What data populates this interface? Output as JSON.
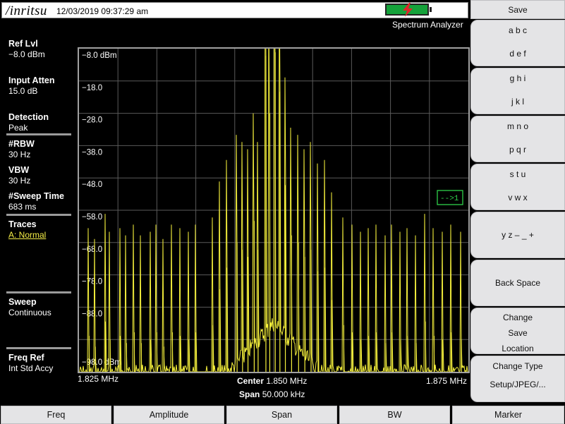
{
  "header": {
    "logo": "/inritsu",
    "datetime": "12/03/2019 09:37:29 am",
    "mode": "Spectrum Analyzer",
    "battery_color": "#15a23a",
    "bolt_color": "#e0262a",
    "battery_icon": "battery-charging-icon"
  },
  "params": [
    {
      "label": "Ref Lvl",
      "value": "−8.0 dBm"
    },
    {
      "label": "Input Atten",
      "value": "15.0 dB"
    },
    {
      "label": "Detection",
      "value": "Peak"
    },
    {
      "label": "#RBW",
      "value": "30 Hz"
    },
    {
      "label": "VBW",
      "value": "30 Hz"
    },
    {
      "label": "#Sweep Time",
      "value": "683 ms"
    },
    {
      "label": "Traces",
      "value": "A: Normal"
    },
    {
      "label": "Sweep",
      "value": "Continuous"
    },
    {
      "label": "Freq Ref",
      "value": "Int Std Accy"
    }
  ],
  "graph": {
    "ref_label": "−8.0 dBm",
    "y_tick_labels": [
      "−18.0",
      "−28.0",
      "−38.0",
      "−48.0",
      "−58.0",
      "−68.0",
      "−78.0",
      "−88.0"
    ],
    "bottom_label": "−98.0 dBm",
    "marker_flag": "-->1",
    "trace_color": "#f5f03c",
    "grid_color": "#5a5a5a",
    "freq_start": "1.825 MHz",
    "freq_stop": "1.875 MHz",
    "center_label": "Center",
    "center_value": "1.850 MHz",
    "span_label": "Span",
    "span_value": "50.000 kHz"
  },
  "softkeys": {
    "save": "Save",
    "abc": "a b c",
    "def": "d e f",
    "ghi": "g h i",
    "jkl": "j k l",
    "mno": "m n o",
    "pqr": "p q r",
    "stu": "s t u",
    "vwx": "v w x",
    "yz": "y z – _ +",
    "backspace": "Back Space",
    "change_save_1": "Change",
    "change_save_2": "Save",
    "change_save_3": "Location",
    "change_type_1": "Change Type",
    "change_type_2": "Setup/JPEG/..."
  },
  "bottom_menu": [
    "Freq",
    "Amplitude",
    "Span",
    "BW",
    "Marker"
  ],
  "chart_data": {
    "type": "line",
    "x_unit": "MHz",
    "y_unit": "dBm",
    "xlim": [
      1.825,
      1.875
    ],
    "ylim": [
      -98,
      -8
    ],
    "noise_floor": -96,
    "peaks": [
      {
        "x": 1.8263,
        "y": -88
      },
      {
        "x": 1.8271,
        "y": -91
      },
      {
        "x": 1.8284,
        "y": -84
      },
      {
        "x": 1.829,
        "y": -89
      },
      {
        "x": 1.8303,
        "y": -88
      },
      {
        "x": 1.8311,
        "y": -90
      },
      {
        "x": 1.8321,
        "y": -87
      },
      {
        "x": 1.833,
        "y": -90
      },
      {
        "x": 1.8342,
        "y": -89
      },
      {
        "x": 1.835,
        "y": -87
      },
      {
        "x": 1.8359,
        "y": -91
      },
      {
        "x": 1.837,
        "y": -87
      },
      {
        "x": 1.838,
        "y": -88
      },
      {
        "x": 1.8391,
        "y": -89
      },
      {
        "x": 1.84,
        "y": -87
      },
      {
        "x": 1.8422,
        "y": -85
      },
      {
        "x": 1.8431,
        "y": -75
      },
      {
        "x": 1.844,
        "y": -69
      },
      {
        "x": 1.8453,
        "y": -62
      },
      {
        "x": 1.846,
        "y": -64
      },
      {
        "x": 1.8467,
        "y": -66
      },
      {
        "x": 1.8475,
        "y": -56
      },
      {
        "x": 1.848,
        "y": -64
      },
      {
        "x": 1.849,
        "y": -10
      },
      {
        "x": 1.8495,
        "y": -26
      },
      {
        "x": 1.8502,
        "y": -9
      },
      {
        "x": 1.8508,
        "y": -20
      },
      {
        "x": 1.8515,
        "y": -46
      },
      {
        "x": 1.8523,
        "y": -60
      },
      {
        "x": 1.8532,
        "y": -62
      },
      {
        "x": 1.854,
        "y": -66
      },
      {
        "x": 1.8548,
        "y": -64
      },
      {
        "x": 1.8557,
        "y": -70
      },
      {
        "x": 1.8566,
        "y": -69
      },
      {
        "x": 1.8575,
        "y": -78
      },
      {
        "x": 1.859,
        "y": -85
      },
      {
        "x": 1.8601,
        "y": -87
      },
      {
        "x": 1.8612,
        "y": -89
      },
      {
        "x": 1.8622,
        "y": -88
      },
      {
        "x": 1.8632,
        "y": -87
      },
      {
        "x": 1.8644,
        "y": -90
      },
      {
        "x": 1.8652,
        "y": -87
      },
      {
        "x": 1.8663,
        "y": -89
      },
      {
        "x": 1.8672,
        "y": -88
      },
      {
        "x": 1.8683,
        "y": -90
      },
      {
        "x": 1.8695,
        "y": -84
      },
      {
        "x": 1.8706,
        "y": -88
      },
      {
        "x": 1.8717,
        "y": -89
      },
      {
        "x": 1.8728,
        "y": -87
      },
      {
        "x": 1.8741,
        "y": -89
      }
    ],
    "marker": {
      "x": 1.8502,
      "y": -9
    }
  }
}
